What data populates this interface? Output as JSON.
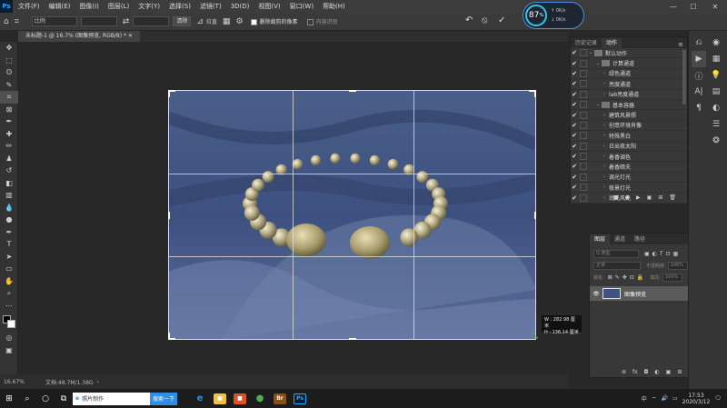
{
  "menubar": {
    "logo": "Ps",
    "items": [
      "文件(F)",
      "编辑(E)",
      "图像(I)",
      "图层(L)",
      "文字(Y)",
      "选择(S)",
      "滤镜(T)",
      "3D(D)",
      "视图(V)",
      "窗口(W)",
      "帮助(H)"
    ],
    "min_label": "—",
    "max_label": "☐",
    "close_label": "✕"
  },
  "options": {
    "crop_icon": "crop-icon",
    "ratio_select": "比例",
    "clear_button": "清除",
    "straighten_label": "拉直",
    "delete_cropped_label": "删除裁剪的像素",
    "content_aware_label": "内容识别",
    "undo_icon": "↶",
    "cancel_icon": "⦸",
    "commit_icon": "✓"
  },
  "gauge": {
    "percent": "87",
    "unit": "%",
    "up_speed": "0K/s",
    "down_speed": "0K/s"
  },
  "document": {
    "tab_label": "未标题-1 @ 16.7% (图像预览, RGB/8) *"
  },
  "crop_overlay": {
    "width_text": "W : 282.98 厘米",
    "height_text": "H : 136.14 厘米"
  },
  "status": {
    "zoom": "16.67%",
    "doc_info": "文档:48.7M/1.38G",
    "arrow": "›"
  },
  "actions_panel": {
    "tabs": [
      "历史记录",
      "动作"
    ],
    "menu_icon": "≡",
    "rows": [
      {
        "label": "默认动作",
        "level": 0,
        "folder": true
      },
      {
        "label": "计算通道",
        "level": 1,
        "folder": true
      },
      {
        "label": "绿色通道",
        "level": 2,
        "folder": false
      },
      {
        "label": "亮度通道",
        "level": 2,
        "folder": false
      },
      {
        "label": "lab亮度通道",
        "level": 2,
        "folder": false
      },
      {
        "label": "基本容器",
        "level": 1,
        "folder": true
      },
      {
        "label": "建筑风景照",
        "level": 2,
        "folder": false
      },
      {
        "label": "创意环境肖像",
        "level": 2,
        "folder": false
      },
      {
        "label": "特殊黑白",
        "level": 2,
        "folder": false
      },
      {
        "label": "日出夜太阳",
        "level": 2,
        "folder": false
      },
      {
        "label": "着香调色",
        "level": 2,
        "folder": false
      },
      {
        "label": "着香暗夫",
        "level": 2,
        "folder": false
      },
      {
        "label": "调光灯光",
        "level": 2,
        "folder": false
      },
      {
        "label": "夜景灯光",
        "level": 2,
        "folder": false
      },
      {
        "label": "润光风光",
        "level": 2,
        "folder": false
      }
    ],
    "bottom_icons": [
      "■",
      "●",
      "▶",
      "▣",
      "⊞",
      "🗑"
    ]
  },
  "layers_panel": {
    "tabs": [
      "图层",
      "通道",
      "路径"
    ],
    "search_placeholder": "Q 类型",
    "blend_mode": "正常",
    "opacity_label": "不透明度:",
    "opacity_value": "100%",
    "lock_label": "锁定:",
    "fill_label": "填充:",
    "fill_value": "100%",
    "layer_name": "图像预览",
    "bottom_icons": [
      "⊛",
      "fx",
      "◘",
      "◐",
      "▣",
      "⊞",
      "🗑"
    ]
  },
  "taskbar": {
    "search_text": "照片制作",
    "search_button": "搜索一下",
    "time": "17:53",
    "date": "2020/3/12",
    "ime_label": "中",
    "notify_icon": "🗨",
    "apps": [
      {
        "name": "edge",
        "label": "e",
        "color": "#2f8de4"
      },
      {
        "name": "explorer",
        "label": "■",
        "color": "#f0c040"
      },
      {
        "name": "store",
        "label": "■",
        "color": "#e05020"
      },
      {
        "name": "chrome",
        "label": "●",
        "color": "#4caf50"
      },
      {
        "name": "bridge",
        "label": "Br",
        "color": "#8a4f12"
      },
      {
        "name": "photoshop",
        "label": "Ps",
        "color": "#001e36"
      }
    ]
  },
  "colors": {
    "accent": "#31a8ff",
    "panel": "#383838",
    "canvas": "#282828"
  }
}
